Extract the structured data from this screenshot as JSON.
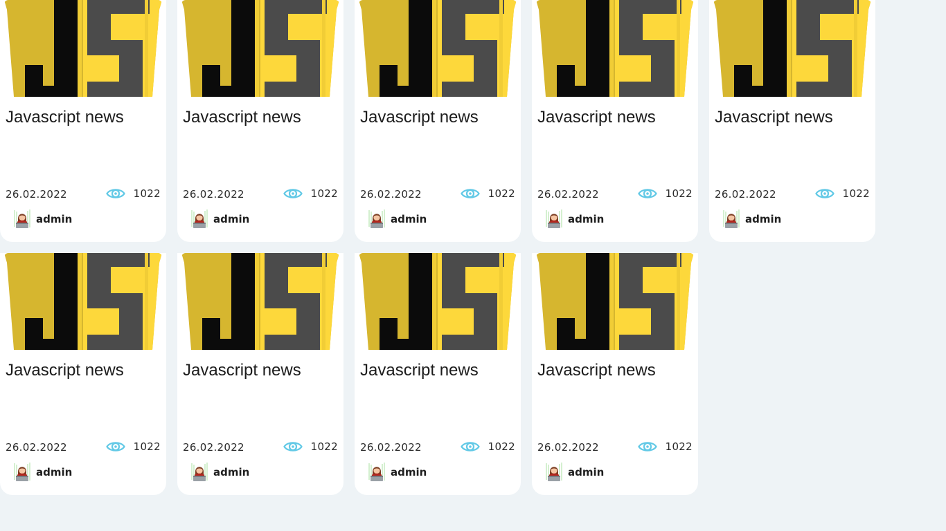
{
  "news": {
    "items": [
      {
        "title": "Javascript news",
        "date": "26.02.2022",
        "views": "1022",
        "author": "admin",
        "logo": "js-logo"
      },
      {
        "title": "Javascript news",
        "date": "26.02.2022",
        "views": "1022",
        "author": "admin",
        "logo": "js-logo"
      },
      {
        "title": "Javascript news",
        "date": "26.02.2022",
        "views": "1022",
        "author": "admin",
        "logo": "js-logo"
      },
      {
        "title": "Javascript news",
        "date": "26.02.2022",
        "views": "1022",
        "author": "admin",
        "logo": "js-logo"
      },
      {
        "title": "Javascript news",
        "date": "26.02.2022",
        "views": "1022",
        "author": "admin",
        "logo": "js-logo"
      },
      {
        "title": "Javascript news",
        "date": "26.02.2022",
        "views": "1022",
        "author": "admin",
        "logo": "js-logo"
      },
      {
        "title": "Javascript news",
        "date": "26.02.2022",
        "views": "1022",
        "author": "admin",
        "logo": "js-logo"
      },
      {
        "title": "Javascript news",
        "date": "26.02.2022",
        "views": "1022",
        "author": "admin",
        "logo": "js-logo"
      },
      {
        "title": "Javascript news",
        "date": "26.02.2022",
        "views": "1022",
        "author": "admin",
        "logo": "js-logo"
      }
    ]
  },
  "icons": {
    "views": "eye-icon",
    "author": "avatar"
  },
  "colors": {
    "page_background": "#eef3f6",
    "card_background": "#ffffff",
    "js_yellow": "#fdd83b",
    "js_yellow_dark": "#d6b62f",
    "js_dark": "#4b4b4b",
    "eye_icon": "#62c9e6"
  }
}
